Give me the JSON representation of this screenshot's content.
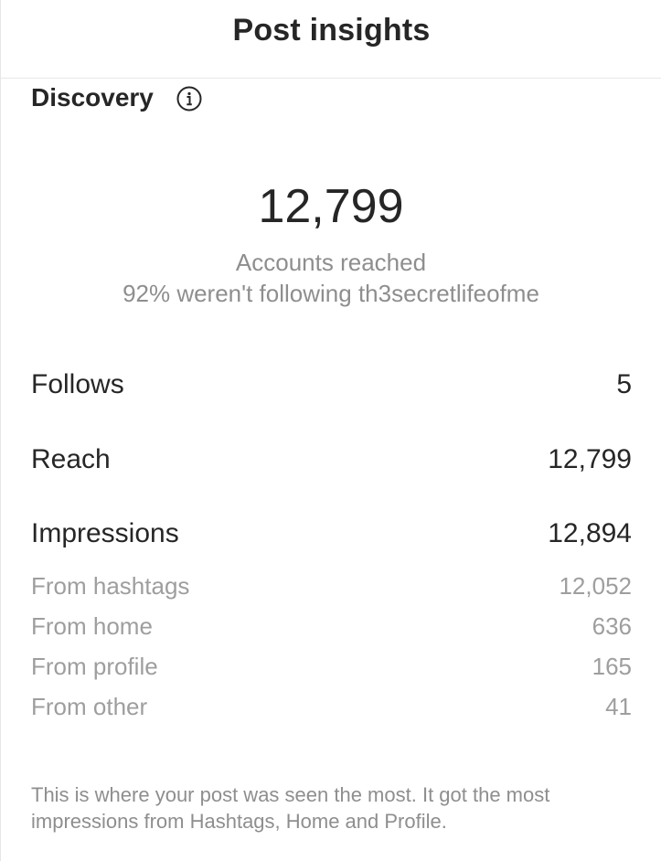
{
  "header": {
    "title": "Post insights"
  },
  "discovery": {
    "title": "Discovery",
    "info_icon": "info-icon",
    "accounts_reached": "12,799",
    "accounts_reached_label": "Accounts reached",
    "not_following_line": "92% weren't following th3secretlifeofme"
  },
  "metrics": {
    "follows": {
      "label": "Follows",
      "value": "5"
    },
    "reach": {
      "label": "Reach",
      "value": "12,799"
    },
    "impressions": {
      "label": "Impressions",
      "value": "12,894"
    }
  },
  "impression_sources": [
    {
      "label": "From hashtags",
      "value": "12,052"
    },
    {
      "label": "From home",
      "value": "636"
    },
    {
      "label": "From profile",
      "value": "165"
    },
    {
      "label": "From other",
      "value": "41"
    }
  ],
  "footer": {
    "note": "This is where your post was seen the most. It got the most impressions from Hashtags, Home and Profile."
  },
  "colors": {
    "primary_text": "#262626",
    "secondary_text": "#8e8e8e",
    "divider": "#e8e8e8"
  }
}
